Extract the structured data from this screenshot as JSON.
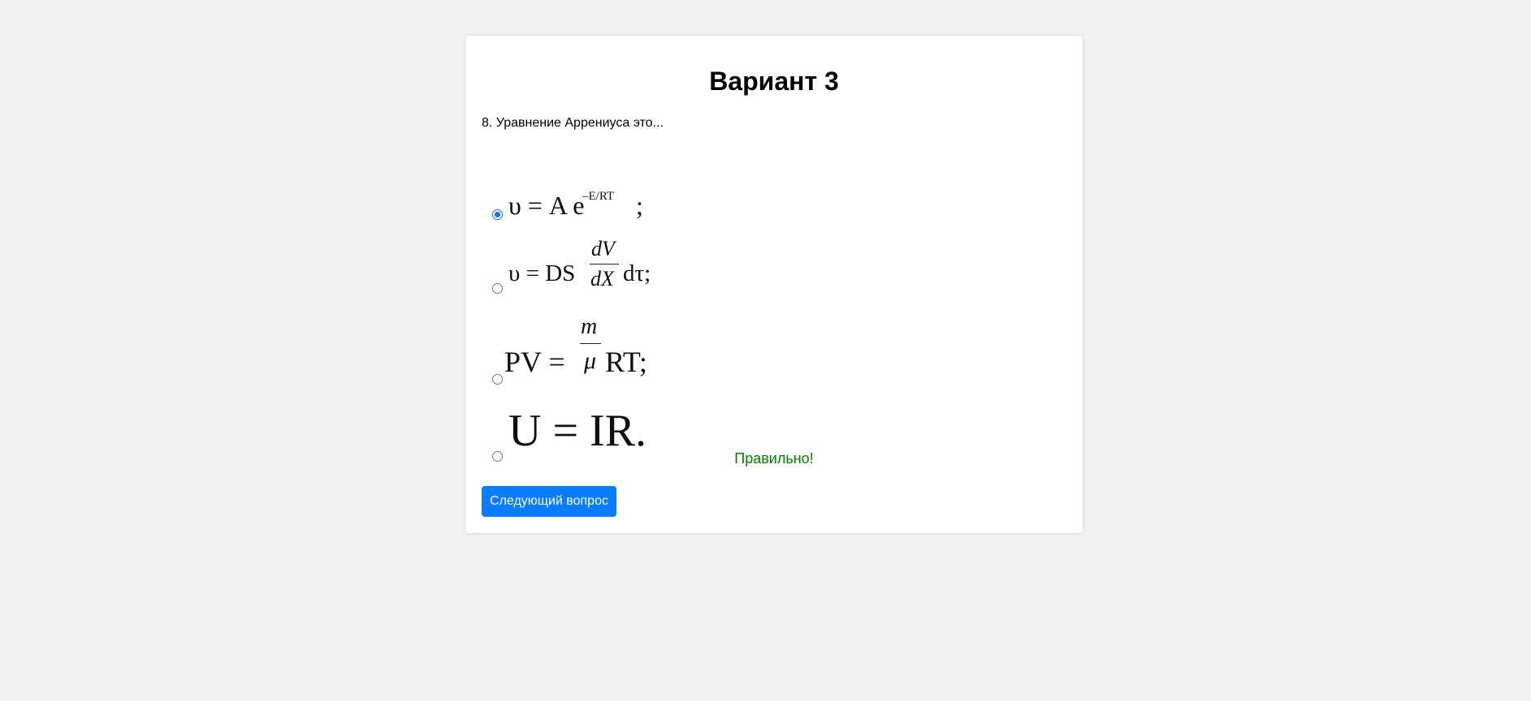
{
  "quiz": {
    "title": "Вариант 3",
    "question": "8. Уравнение Аррениуса это...",
    "options": [
      {
        "selected": true,
        "formula": {
          "lhs": "υ = A e",
          "exponent": "–E/RT",
          "tail": ";"
        }
      },
      {
        "selected": false,
        "formula": {
          "lhs": "υ = DS",
          "numerator": "dV",
          "denominator": "dX",
          "tail": "dτ;"
        }
      },
      {
        "selected": false,
        "formula": {
          "lhs": "PV =",
          "numerator": "m",
          "denominator": "μ",
          "tail": "RT;"
        }
      },
      {
        "selected": false,
        "formula": {
          "text": "U = IR."
        }
      }
    ],
    "feedback": "Правильно!",
    "next_button": "Следующий вопрос"
  },
  "colors": {
    "page_background": "#f2f2f2",
    "card_background": "#ffffff",
    "correct": "#008000",
    "button": "#0a7cff",
    "radio_checked": "#1a73e8"
  }
}
